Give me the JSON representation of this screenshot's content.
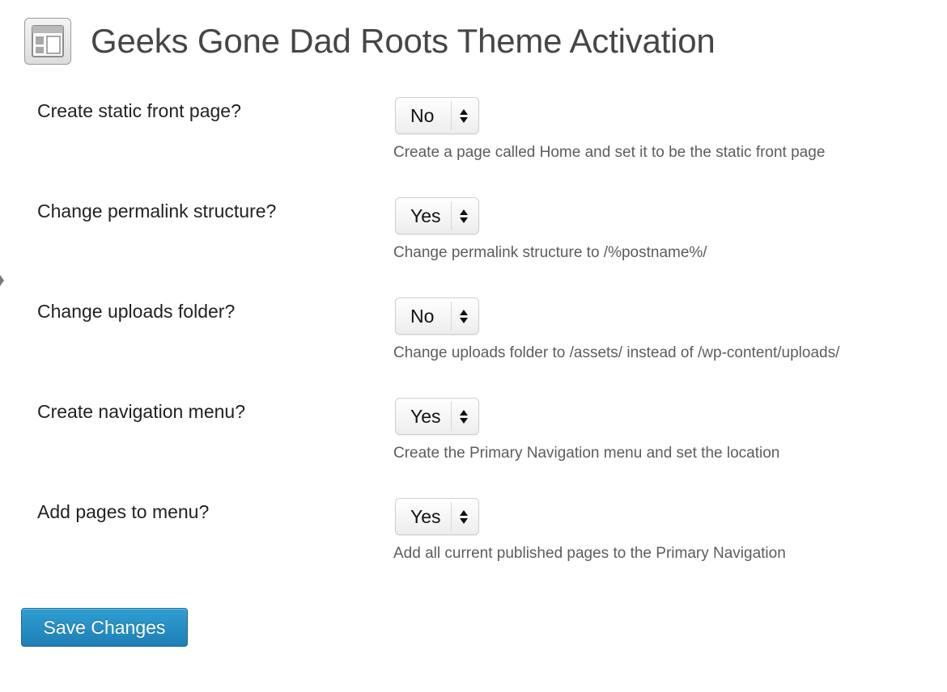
{
  "header": {
    "title": "Geeks Gone Dad Roots Theme Activation"
  },
  "options": [
    {
      "label": "Create static front page?",
      "value": "No",
      "description": "Create a page called Home and set it to be the static front page"
    },
    {
      "label": "Change permalink structure?",
      "value": "Yes",
      "description": "Change permalink structure to /%postname%/"
    },
    {
      "label": "Change uploads folder?",
      "value": "No",
      "description": "Change uploads folder to /assets/ instead of /wp-content/uploads/"
    },
    {
      "label": "Create navigation menu?",
      "value": "Yes",
      "description": "Create the Primary Navigation menu and set the location"
    },
    {
      "label": "Add pages to menu?",
      "value": "Yes",
      "description": "Add all current published pages to the Primary Navigation"
    }
  ],
  "actions": {
    "save_label": "Save Changes"
  },
  "colors": {
    "button_primary": "#2e9fd2",
    "title_text": "#464646",
    "description_text": "#5d5d5d"
  },
  "icons": {
    "page_icon": "appearance-layout-icon",
    "select_arrows": "up-down-arrows-icon"
  }
}
